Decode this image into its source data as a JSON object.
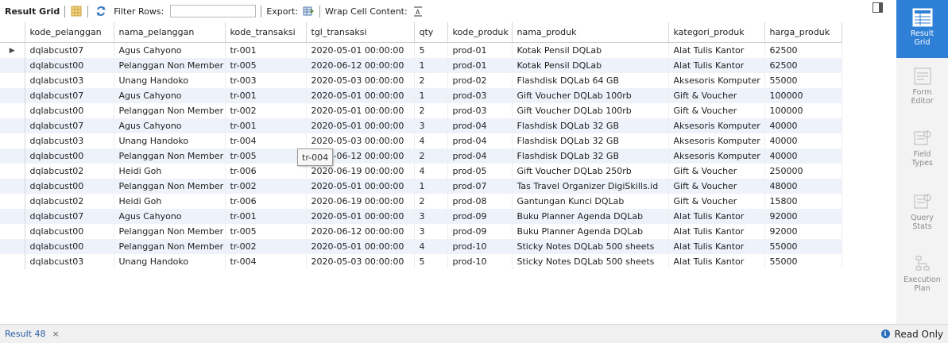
{
  "toolbar": {
    "result_grid": "Result Grid",
    "filter_rows": "Filter Rows:",
    "filter_value": "",
    "export": "Export:",
    "wrap_cell": "Wrap Cell Content:"
  },
  "columns": [
    "kode_pelanggan",
    "nama_pelanggan",
    "kode_transaksi",
    "tgl_transaksi",
    "qty",
    "kode_produk",
    "nama_produk",
    "kategori_produk",
    "harga_produk"
  ],
  "rows": [
    [
      "dqlabcust07",
      "Agus Cahyono",
      "tr-001",
      "2020-05-01 00:00:00",
      "5",
      "prod-01",
      "Kotak Pensil DQLab",
      "Alat Tulis Kantor",
      "62500"
    ],
    [
      "dqlabcust00",
      "Pelanggan Non Member",
      "tr-005",
      "2020-06-12 00:00:00",
      "1",
      "prod-01",
      "Kotak Pensil DQLab",
      "Alat Tulis Kantor",
      "62500"
    ],
    [
      "dqlabcust03",
      "Unang Handoko",
      "tr-003",
      "2020-05-03 00:00:00",
      "2",
      "prod-02",
      "Flashdisk DQLab 64 GB",
      "Aksesoris Komputer",
      "55000"
    ],
    [
      "dqlabcust07",
      "Agus Cahyono",
      "tr-001",
      "2020-05-01 00:00:00",
      "1",
      "prod-03",
      "Gift Voucher DQLab 100rb",
      "Gift & Voucher",
      "100000"
    ],
    [
      "dqlabcust00",
      "Pelanggan Non Member",
      "tr-002",
      "2020-05-01 00:00:00",
      "2",
      "prod-03",
      "Gift Voucher DQLab 100rb",
      "Gift & Voucher",
      "100000"
    ],
    [
      "dqlabcust07",
      "Agus Cahyono",
      "tr-001",
      "2020-05-01 00:00:00",
      "3",
      "prod-04",
      "Flashdisk DQLab 32 GB",
      "Aksesoris Komputer",
      "40000"
    ],
    [
      "dqlabcust03",
      "Unang Handoko",
      "tr-004",
      "2020-05-03 00:00:00",
      "4",
      "prod-04",
      "Flashdisk DQLab 32 GB",
      "Aksesoris Komputer",
      "40000"
    ],
    [
      "dqlabcust00",
      "Pelanggan Non Member",
      "tr-005",
      "2020-06-12 00:00:00",
      "2",
      "prod-04",
      "Flashdisk DQLab 32 GB",
      "Aksesoris Komputer",
      "40000"
    ],
    [
      "dqlabcust02",
      "Heidi Goh",
      "tr-006",
      "2020-06-19 00:00:00",
      "4",
      "prod-05",
      "Gift Voucher DQLab 250rb",
      "Gift & Voucher",
      "250000"
    ],
    [
      "dqlabcust00",
      "Pelanggan Non Member",
      "tr-002",
      "2020-05-01 00:00:00",
      "1",
      "prod-07",
      "Tas Travel Organizer DigiSkills.id",
      "Gift & Voucher",
      "48000"
    ],
    [
      "dqlabcust02",
      "Heidi Goh",
      "tr-006",
      "2020-06-19 00:00:00",
      "2",
      "prod-08",
      "Gantungan Kunci DQLab",
      "Gift & Voucher",
      "15800"
    ],
    [
      "dqlabcust07",
      "Agus Cahyono",
      "tr-001",
      "2020-05-01 00:00:00",
      "3",
      "prod-09",
      "Buku Planner Agenda DQLab",
      "Alat Tulis Kantor",
      "92000"
    ],
    [
      "dqlabcust00",
      "Pelanggan Non Member",
      "tr-005",
      "2020-06-12 00:00:00",
      "3",
      "prod-09",
      "Buku Planner Agenda DQLab",
      "Alat Tulis Kantor",
      "92000"
    ],
    [
      "dqlabcust00",
      "Pelanggan Non Member",
      "tr-002",
      "2020-05-01 00:00:00",
      "4",
      "prod-10",
      "Sticky Notes DQLab 500 sheets",
      "Alat Tulis Kantor",
      "55000"
    ],
    [
      "dqlabcust03",
      "Unang Handoko",
      "tr-004",
      "2020-05-03 00:00:00",
      "5",
      "prod-10",
      "Sticky Notes DQLab 500 sheets",
      "Alat Tulis Kantor",
      "55000"
    ]
  ],
  "current_row_marker": "▶",
  "tooltip": "tr-004",
  "sidebar": [
    {
      "line1": "Result",
      "line2": "Grid",
      "icon": "result-grid-icon",
      "active": true
    },
    {
      "line1": "Form",
      "line2": "Editor",
      "icon": "form-editor-icon",
      "active": false
    },
    {
      "line1": "Field",
      "line2": "Types",
      "icon": "field-types-icon",
      "active": false
    },
    {
      "line1": "Query",
      "line2": "Stats",
      "icon": "query-stats-icon",
      "active": false
    },
    {
      "line1": "Execution",
      "line2": "Plan",
      "icon": "execution-plan-icon",
      "active": false
    }
  ],
  "bottom": {
    "result_tab": "Result 48",
    "close_glyph": "×",
    "read_only": "Read Only"
  },
  "colors": {
    "accent": "#2e7fd6",
    "row_alt": "#eef3fb",
    "tab_text": "#2b5fa5"
  }
}
